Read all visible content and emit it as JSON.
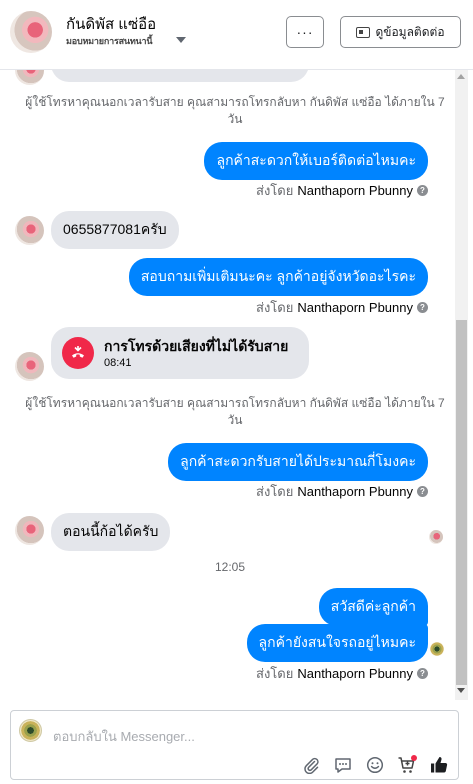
{
  "header": {
    "name": "กันดิพัส แซ่อือ",
    "subtitle": "มอบหมายการสนทนานี้",
    "more_label": "···",
    "contact_label": "ดูข้อมูลติดต่อ"
  },
  "messages": {
    "sys_note_1": "ผู้ใช้โทรหาคุณนอกเวลารับสาย คุณสามารถโทรกลับหา กันดิพัส แซ่อือ ได้ภายใน 7 วัน",
    "out_1": "ลูกค้าสะดวกให้เบอร์ติดต่อไหมคะ",
    "sent_by_prefix": "ส่งโดย",
    "sent_by_name": "Nanthaporn Pbunny",
    "in_1": "0655877081ครับ",
    "out_2": "สอบถามเพิ่มเติมนะคะ ลูกค้าอยู่จังหวัดอะไรคะ",
    "call_title": "การโทรด้วยเสียงที่ไม่ได้รับสาย",
    "call_time": "08:41",
    "sys_note_2": "ผู้ใช้โทรหาคุณนอกเวลารับสาย คุณสามารถโทรกลับหา กันดิพัส แซ่อือ ได้ภายใน 7 วัน",
    "out_3": "ลูกค้าสะดวกรับสายได้ประมาณกี่โมงคะ",
    "in_2": "ตอนนี้ก้อได้ครับ",
    "time_sep": "12:05",
    "out_4": "สวัสดีค่ะลูกค้า",
    "out_5": "ลูกค้ายังสนใจรถอยู่ไหมคะ"
  },
  "composer": {
    "placeholder": "ตอบกลับใน Messenger..."
  },
  "colors": {
    "outgoing": "#0084ff",
    "incoming": "#e4e6eb",
    "missed_call": "#f02849",
    "reaction_badge": "#f02849"
  }
}
